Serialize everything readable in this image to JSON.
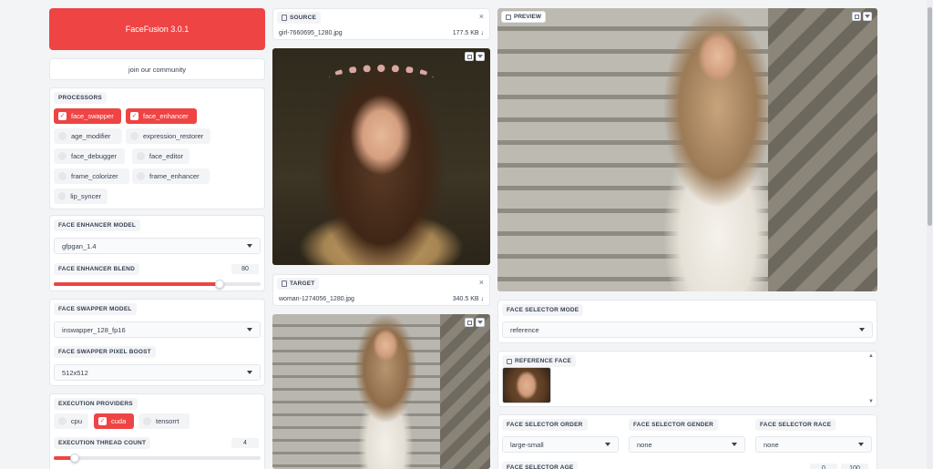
{
  "app": {
    "title": "FaceFusion 3.0.1",
    "community": "join our community",
    "accent": "#ef4444"
  },
  "processors": {
    "label": "PROCESSORS",
    "items": [
      {
        "label": "face_swapper",
        "checked": true
      },
      {
        "label": "face_enhancer",
        "checked": true
      },
      {
        "label": "age_modifier",
        "checked": false
      },
      {
        "label": "expression_restorer",
        "checked": false
      },
      {
        "label": "face_debugger",
        "checked": false
      },
      {
        "label": "face_editor",
        "checked": false
      },
      {
        "label": "frame_colorizer",
        "checked": false
      },
      {
        "label": "frame_enhancer",
        "checked": false
      },
      {
        "label": "lip_syncer",
        "checked": false
      }
    ]
  },
  "face_enhancer": {
    "model_label": "FACE ENHANCER MODEL",
    "model_value": "gfpgan_1.4",
    "blend_label": "FACE ENHANCER BLEND",
    "blend_value": "80",
    "blend_fraction": 0.8
  },
  "face_swapper": {
    "model_label": "FACE SWAPPER MODEL",
    "model_value": "inswapper_128_fp16",
    "boost_label": "FACE SWAPPER PIXEL BOOST",
    "boost_value": "512x512"
  },
  "execution": {
    "providers_label": "EXECUTION PROVIDERS",
    "providers": [
      {
        "label": "cpu",
        "checked": false
      },
      {
        "label": "cuda",
        "checked": true
      },
      {
        "label": "tensorrt",
        "checked": false
      }
    ],
    "thread_label": "EXECUTION THREAD COUNT",
    "thread_value": "4",
    "thread_fraction": 0.1
  },
  "source": {
    "label": "SOURCE",
    "filename": "girl-7660695_1280.jpg",
    "size": "177.5 KB ↓"
  },
  "target": {
    "label": "TARGET",
    "filename": "woman-1274056_1280.jpg",
    "size": "340.5 KB ↓"
  },
  "preview": {
    "label": "PREVIEW"
  },
  "face_selector": {
    "mode_label": "FACE SELECTOR MODE",
    "mode_value": "reference",
    "reference_label": "REFERENCE FACE",
    "order_label": "FACE SELECTOR ORDER",
    "order_value": "large-small",
    "gender_label": "FACE SELECTOR GENDER",
    "gender_value": "none",
    "race_label": "FACE SELECTOR RACE",
    "race_value": "none",
    "age_label": "FACE SELECTOR AGE",
    "age_min": "0",
    "age_max": "100"
  }
}
